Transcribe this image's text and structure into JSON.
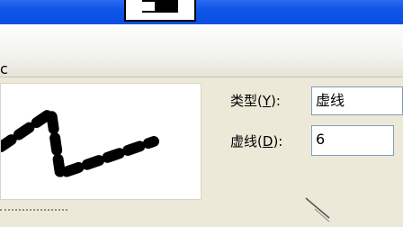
{
  "dialog": {
    "header_fragment": "c"
  },
  "line_type": {
    "label_text": "类型",
    "label_paren_open": "(",
    "label_accel": "Y",
    "label_paren_close": "):",
    "value": "虚线"
  },
  "dash": {
    "label_text": "虚线",
    "label_paren_open": "(",
    "label_accel": "D",
    "label_paren_close": "):",
    "value": "6"
  },
  "colors": {
    "titlebar": "#0f54e8",
    "dialog_bg": "#ece9d8",
    "input_border": "#7f9db9"
  }
}
